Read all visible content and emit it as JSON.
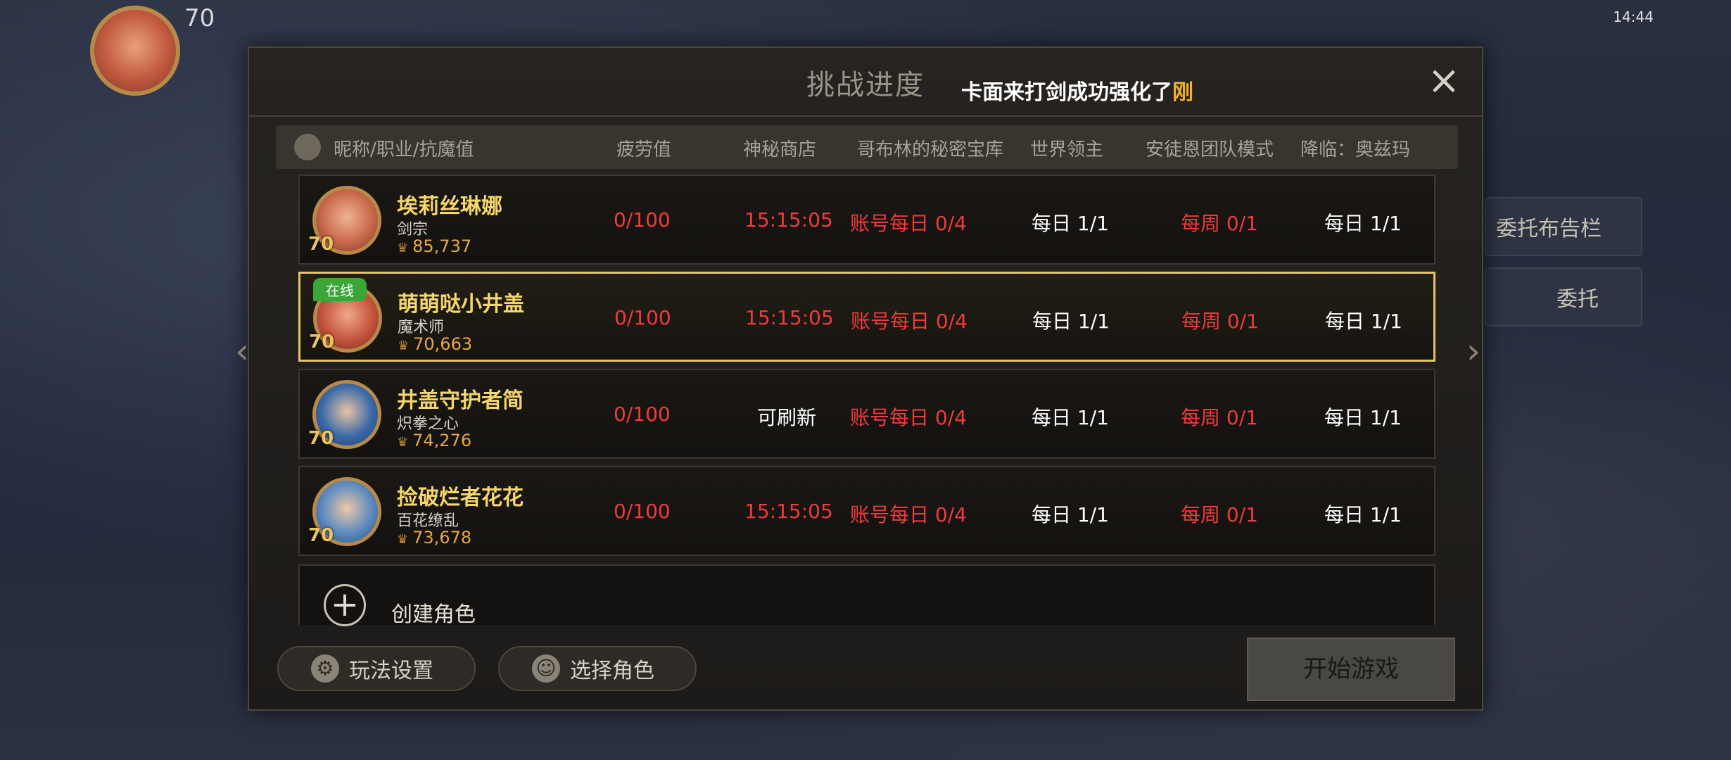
{
  "background": {
    "level": "70",
    "status_bar": "14:44",
    "side_labels": [
      "委托布告栏",
      "委托"
    ]
  },
  "panel": {
    "title": "挑战进度",
    "ticker_prefix": "卡面来打剑成功强化了",
    "ticker_highlight": "刚",
    "close_label": "×"
  },
  "columns": [
    "昵称/职业/抗魔值",
    "疲劳值",
    "神秘商店",
    "哥布林的秘密宝库",
    "世界领主",
    "安徒恩团队模式",
    "降临：奥兹玛"
  ],
  "characters": [
    {
      "name": "埃莉丝琳娜",
      "job": "剑宗",
      "power": "85,737",
      "level": "70",
      "online": "",
      "fatigue": "0/100",
      "shop": "15:15:05",
      "goblin": "账号每日 0/4",
      "world_boss": "每日 1/1",
      "anton": "每周 0/1",
      "ozma": "每日 1/1"
    },
    {
      "name": "萌萌哒小井盖",
      "job": "魔术师",
      "power": "70,663",
      "level": "70",
      "online": "在线",
      "fatigue": "0/100",
      "shop": "15:15:05",
      "goblin": "账号每日 0/4",
      "world_boss": "每日 1/1",
      "anton": "每周 0/1",
      "ozma": "每日 1/1"
    },
    {
      "name": "井盖守护者简",
      "job": "炽拳之心",
      "power": "74,276",
      "level": "70",
      "online": "",
      "fatigue": "0/100",
      "shop": "可刷新",
      "goblin": "账号每日 0/4",
      "world_boss": "每日 1/1",
      "anton": "每周 0/1",
      "ozma": "每日 1/1"
    },
    {
      "name": "捡破烂者花花",
      "job": "百花缭乱",
      "power": "73,678",
      "level": "70",
      "online": "",
      "fatigue": "0/100",
      "shop": "15:15:05",
      "goblin": "账号每日 0/4",
      "world_boss": "每日 1/1",
      "anton": "每周 0/1",
      "ozma": "每日 1/1"
    }
  ],
  "create": {
    "label": "创建角色",
    "icon": "plus-icon"
  },
  "footer": {
    "settings_label": "玩法设置",
    "select_label": "选择角色",
    "start_label": "开始游戏"
  },
  "colors": {
    "name": "#f4d66c",
    "red": "#ee3b3b",
    "online": "#3aa638",
    "selected_border": "#e6c660"
  }
}
